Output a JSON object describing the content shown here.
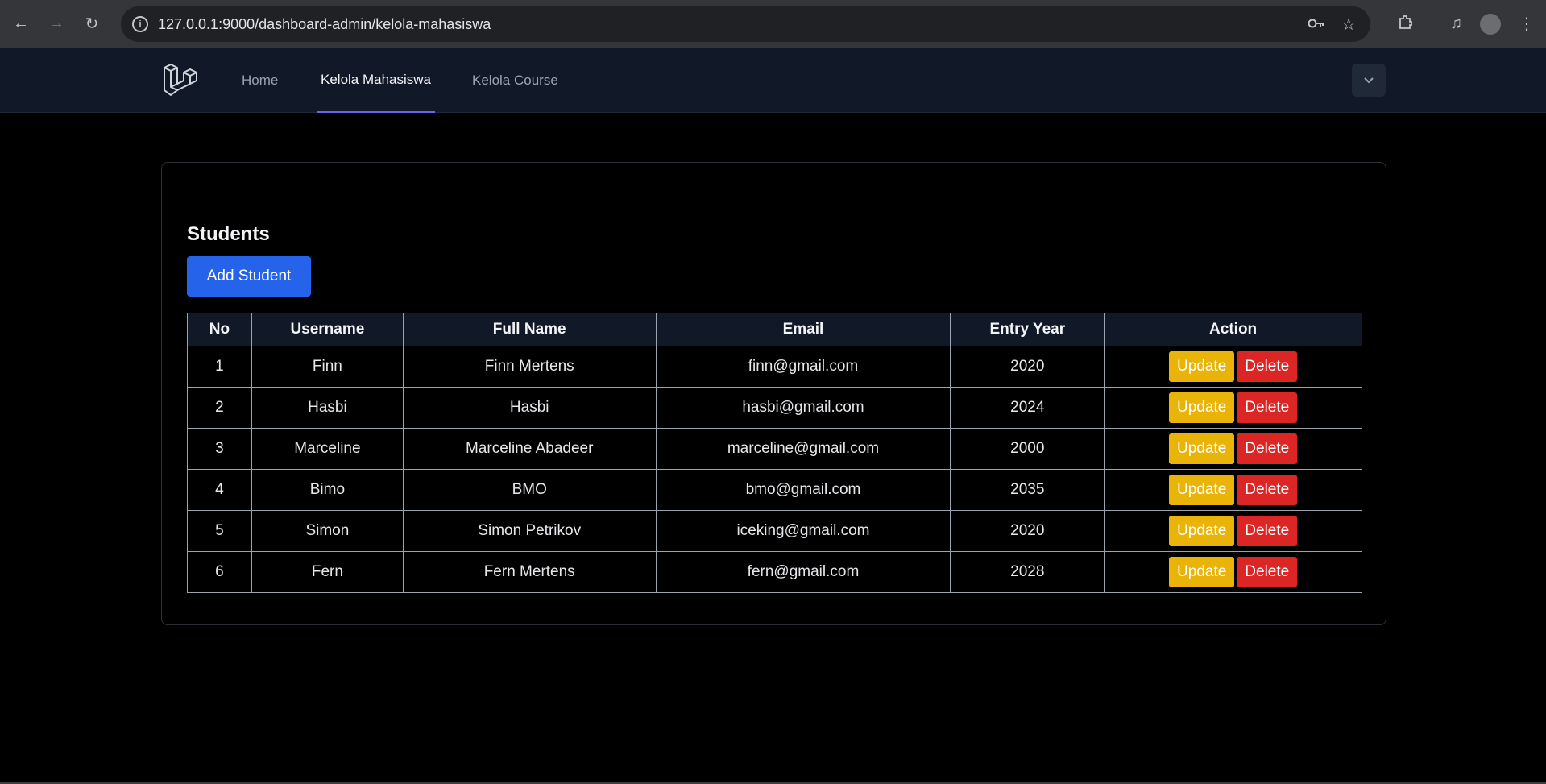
{
  "browser": {
    "url": "127.0.0.1:9000/dashboard-admin/kelola-mahasiswa",
    "icons": [
      "back-icon",
      "forward-icon",
      "reload-icon",
      "site-info-icon",
      "key-icon",
      "star-icon",
      "extensions-icon",
      "media-icon",
      "profile-icon",
      "menu-icon"
    ]
  },
  "nav": {
    "links": [
      {
        "label": "Home"
      },
      {
        "label": "Kelola Mahasiswa"
      },
      {
        "label": "Kelola Course"
      }
    ],
    "active": "Kelola Mahasiswa"
  },
  "page": {
    "title": "Students",
    "add_label": "Add Student"
  },
  "table": {
    "headers": [
      "No",
      "Username",
      "Full Name",
      "Email",
      "Entry Year",
      "Action"
    ],
    "rows": [
      {
        "no": "1",
        "username": "Finn",
        "full_name": "Finn Mertens",
        "email": "finn@gmail.com",
        "year": "2020"
      },
      {
        "no": "2",
        "username": "Hasbi",
        "full_name": "Hasbi",
        "email": "hasbi@gmail.com",
        "year": "2024"
      },
      {
        "no": "3",
        "username": "Marceline",
        "full_name": "Marceline Abadeer",
        "email": "marceline@gmail.com",
        "year": "2000"
      },
      {
        "no": "4",
        "username": "Bimo",
        "full_name": "BMO",
        "email": "bmo@gmail.com",
        "year": "2035"
      },
      {
        "no": "5",
        "username": "Simon",
        "full_name": "Simon Petrikov",
        "email": "iceking@gmail.com",
        "year": "2020"
      },
      {
        "no": "6",
        "username": "Fern",
        "full_name": "Fern Mertens",
        "email": "fern@gmail.com",
        "year": "2028"
      }
    ],
    "update_label": "Update",
    "delete_label": "Delete"
  },
  "colors": {
    "accent": "#2563eb",
    "update": "#eab308",
    "delete": "#dc2626",
    "active_underline": "#6366f1"
  }
}
